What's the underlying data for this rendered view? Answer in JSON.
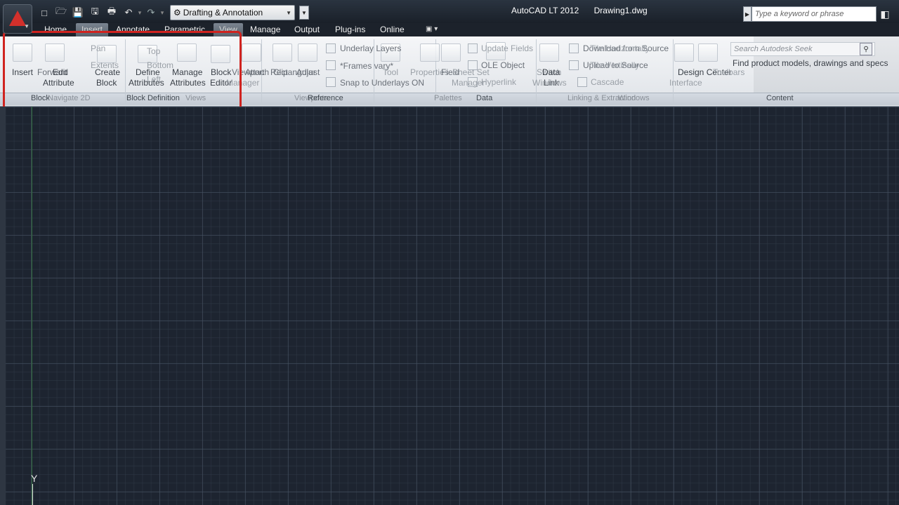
{
  "app": {
    "title": "AutoCAD LT 2012",
    "document": "Drawing1.dwg",
    "workspace": "Drafting & Annotation",
    "search_placeholder": "Type a keyword or phrase"
  },
  "tabs": [
    {
      "label": "Home"
    },
    {
      "label": "Insert"
    },
    {
      "label": "Annotate"
    },
    {
      "label": "Parametric"
    },
    {
      "label": "View"
    },
    {
      "label": "Manage"
    },
    {
      "label": "Output"
    },
    {
      "label": "Plug-ins"
    },
    {
      "label": "Online"
    }
  ],
  "ribbon": {
    "block": {
      "insert": "Insert",
      "edit_attribute_1": "Edit",
      "edit_attribute_2": "Attribute",
      "create_block_1": "Create",
      "create_block_2": "Block"
    },
    "block_definition": {
      "define_1": "Define",
      "define_2": "Attributes",
      "manage_1": "Manage",
      "manage_2": "Attributes",
      "editor_1": "Block",
      "editor_2": "Editor"
    },
    "navigate": {
      "pan": "Pan",
      "extents": "Extents",
      "forward": "Forward"
    },
    "views": {
      "top": "Top",
      "bottom": "Bottom",
      "left": "Left",
      "viewport": "Viewport"
    },
    "reference": {
      "attach": "Attach",
      "clip": "Clip",
      "adjust": "Adjust",
      "rectangular": "Rectangular",
      "underlay_layers": "Underlay Layers",
      "frames_vary": "*Frames vary*",
      "snap_underlays": "Snap to Underlays ON",
      "manager": "Manager"
    },
    "palettes": {
      "tool": "Tool",
      "properties": "Properties",
      "sheet_set": "Sheet Set",
      "manager": "Manager"
    },
    "data": {
      "field": "Field",
      "update_fields": "Update Fields",
      "ole_object": "OLE Object",
      "hyperlink": "Hyperlink"
    },
    "linking": {
      "data_link": "Data",
      "data_link_2": "Link",
      "download_from_source": "Download from Source",
      "upload_to_source": "Upload to Source",
      "tile_horizontally": "Tile Horizontally",
      "tile_vertically": "Tile Vertically",
      "cascade": "Cascade",
      "switch": "Switch",
      "windows": "Windows"
    },
    "interface": {
      "design_center": "Design Center",
      "toolbars": "Toolbars",
      "interface": "Interface"
    },
    "content": {
      "seek_placeholder": "Search Autodesk Seek",
      "find": "Find product models, drawings and specs",
      "label": "Content"
    }
  },
  "panel_labels": {
    "block": "Block",
    "navigate_2d": "Navigate 2D",
    "block_definition": "Block Definition",
    "views": "Views",
    "viewports": "Viewports",
    "reference": "Reference",
    "palettes": "Palettes",
    "data": "Data",
    "linking_extraction": "Linking & Extraction",
    "windows": "Windows",
    "content": "Content"
  },
  "canvas": {
    "ucs_y": "Y"
  }
}
